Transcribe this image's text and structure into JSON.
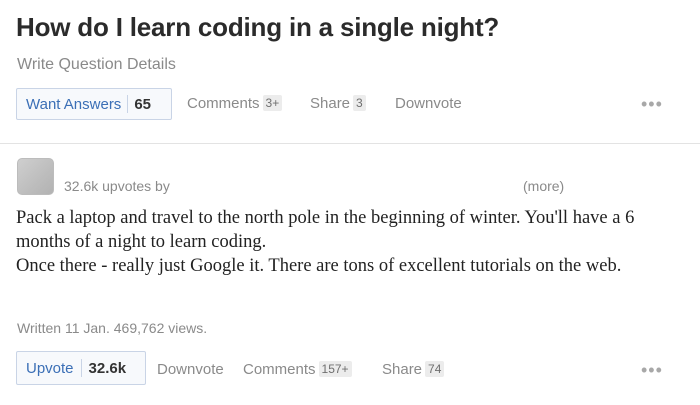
{
  "question": {
    "title": "How do I learn coding in a single night?",
    "details_link": "Write Question Details"
  },
  "question_actions": {
    "want_answers_label": "Want Answers",
    "want_answers_count": "65",
    "comments_label": "Comments",
    "comments_count": "3+",
    "share_label": "Share",
    "share_count": "3",
    "downvote_label": "Downvote",
    "more_icon": "•••"
  },
  "answer": {
    "upvotes_by": "32.6k upvotes by",
    "more_label": "(more)",
    "paragraphs": [
      "Pack a laptop and travel to the north pole in the beginning of winter. You'll have a 6 months of a night to learn coding.",
      "Once there - really just Google it. There are tons of excellent tutorials on the web."
    ],
    "meta": "Written 11 Jan. 469,762 views."
  },
  "answer_actions": {
    "upvote_label": "Upvote",
    "upvote_count": "32.6k",
    "downvote_label": "Downvote",
    "comments_label": "Comments",
    "comments_count": "157+",
    "share_label": "Share",
    "share_count": "74",
    "more_icon": "•••"
  },
  "colors": {
    "link_blue": "#3b6fb6",
    "muted_text": "#8a8a8a",
    "button_border": "#c9d4e6"
  },
  "icons": {
    "more_menu": "more-dots-icon",
    "avatar": "user-avatar"
  }
}
